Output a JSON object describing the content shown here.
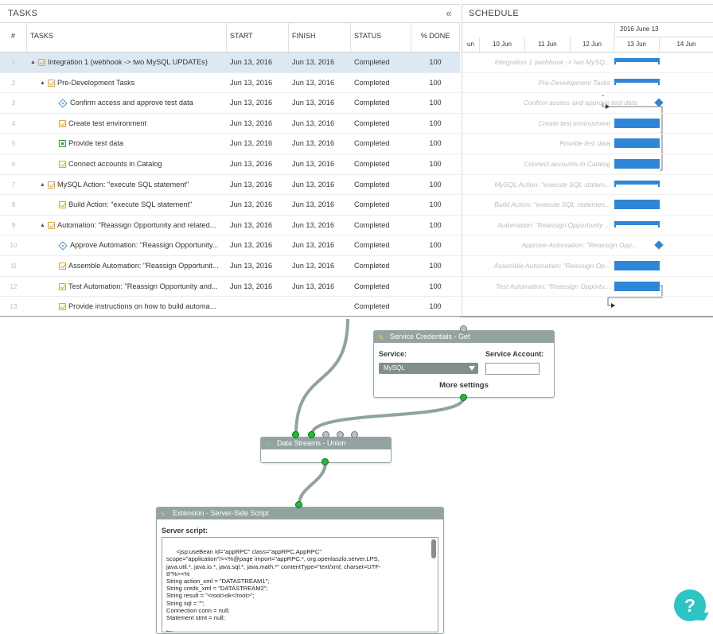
{
  "tasks_panel": {
    "title": "TASKS",
    "collapse_icon": "«",
    "columns": [
      "#",
      "TASKS",
      "START",
      "FINISH",
      "STATUS",
      "% DONE"
    ],
    "rows": [
      {
        "num": "1",
        "indent": 0,
        "expander": "▲",
        "icon": "check",
        "name": "Integration 1 (webhook -> two MySQL UPDATEs)",
        "start": "Jun 13, 2016",
        "finish": "Jun 13, 2016",
        "status": "Completed",
        "done": "100"
      },
      {
        "num": "2",
        "indent": 1,
        "expander": "▲",
        "icon": "check",
        "name": "Pre-Development Tasks",
        "start": "Jun 13, 2016",
        "finish": "Jun 13, 2016",
        "status": "Completed",
        "done": "100"
      },
      {
        "num": "3",
        "indent": 2,
        "expander": "",
        "icon": "dia",
        "name": "Confirm access and approve test data",
        "start": "Jun 13, 2016",
        "finish": "Jun 13, 2016",
        "status": "Completed",
        "done": "100"
      },
      {
        "num": "4",
        "indent": 2,
        "expander": "",
        "icon": "check",
        "name": "Create test environment",
        "start": "Jun 13, 2016",
        "finish": "Jun 13, 2016",
        "status": "Completed",
        "done": "100"
      },
      {
        "num": "5",
        "indent": 2,
        "expander": "",
        "icon": "green",
        "name": "Provide test data",
        "start": "Jun 13, 2016",
        "finish": "Jun 13, 2016",
        "status": "Completed",
        "done": "100"
      },
      {
        "num": "6",
        "indent": 2,
        "expander": "",
        "icon": "check",
        "name": "Connect accounts in Catalog",
        "start": "Jun 13, 2016",
        "finish": "Jun 13, 2016",
        "status": "Completed",
        "done": "100"
      },
      {
        "num": "7",
        "indent": 1,
        "expander": "▲",
        "icon": "check",
        "name": "MySQL Action: \"execute SQL statement\"",
        "start": "Jun 13, 2016",
        "finish": "Jun 13, 2016",
        "status": "Completed",
        "done": "100"
      },
      {
        "num": "8",
        "indent": 2,
        "expander": "",
        "icon": "check",
        "name": "Build Action: \"execute SQL statement\"",
        "start": "Jun 13, 2016",
        "finish": "Jun 13, 2016",
        "status": "Completed",
        "done": "100"
      },
      {
        "num": "9",
        "indent": 1,
        "expander": "▲",
        "icon": "check",
        "name": "Automation: \"Reassign Opportunity and related...",
        "start": "Jun 13, 2016",
        "finish": "Jun 13, 2016",
        "status": "Completed",
        "done": "100"
      },
      {
        "num": "10",
        "indent": 2,
        "expander": "",
        "icon": "dia",
        "name": "Approve Automation: \"Reassign Opportunity...",
        "start": "Jun 13, 2016",
        "finish": "Jun 13, 2016",
        "status": "Completed",
        "done": "100"
      },
      {
        "num": "11",
        "indent": 2,
        "expander": "",
        "icon": "check",
        "name": "Assemble Automation: \"Reassign Opportunit...",
        "start": "Jun 13, 2016",
        "finish": "Jun 13, 2016",
        "status": "Completed",
        "done": "100"
      },
      {
        "num": "12",
        "indent": 2,
        "expander": "",
        "icon": "check",
        "name": "Test Automation: \"Reassign Opportunity and...",
        "start": "Jun 13, 2016",
        "finish": "Jun 13, 2016",
        "status": "Completed",
        "done": "100"
      },
      {
        "num": "13",
        "indent": 2,
        "expander": "",
        "icon": "check",
        "name": "Provide instructions on how to build automa...",
        "start": "",
        "finish": "",
        "status": "Completed",
        "done": "100"
      }
    ]
  },
  "schedule_panel": {
    "title": "SCHEDULE",
    "date_header": "2016 June 13",
    "days": [
      "un",
      "10 Jun",
      "11 Jun",
      "12 Jun",
      "13 Jun",
      "14 Jun"
    ],
    "rows": [
      {
        "label": "Integration 1 (webhook -> two MySQ...",
        "kind": "summary"
      },
      {
        "label": "Pre-Development Tasks",
        "kind": "summary"
      },
      {
        "label": "Confirm access and approve test data",
        "kind": "milestone"
      },
      {
        "label": "Create test environment",
        "kind": "task"
      },
      {
        "label": "Provide test data",
        "kind": "task"
      },
      {
        "label": "Connect accounts in Catalog",
        "kind": "task"
      },
      {
        "label": "MySQL Action: \"execute SQL statem...",
        "kind": "summary"
      },
      {
        "label": "Build Action: \"execute SQL statemen...",
        "kind": "task"
      },
      {
        "label": "Automation: \"Reassign Opportunity ...",
        "kind": "summary"
      },
      {
        "label": "Approve Automation: \"Reassign Opp...",
        "kind": "milestone"
      },
      {
        "label": "Assemble Automation: \"Reassign Op...",
        "kind": "task"
      },
      {
        "label": "Test Automation: \"Reassign Opportu...",
        "kind": "task"
      },
      {
        "label": "",
        "kind": "none"
      }
    ]
  },
  "service_node": {
    "title": "Service Credentials - Get",
    "service_label": "Service:",
    "account_label": "Service Account:",
    "service_value": "MySQL",
    "account_value": "",
    "more_settings": "More settings"
  },
  "union_node": {
    "title": "Data Streams - Union"
  },
  "script_node": {
    "title": "Extension - Server-Side Script",
    "script_label": "Server script:",
    "code": "<jsp:useBean id=\"appRPC\" class=\"appRPC.AppRPC\"\nscope=\"application\"/><%@page import=\"appRPC.*, org.openlaszlo.server.LPS,\njava.util.*, java.io.*, java.sql.*, java.math.*\" contentType=\"text/xml; charset=UTF-\n8\"%><%\nString action_xml = \"DATASTREAM1\";\nString creds_xml = \"DATASTREAM2\";\nString result = \"<root>ok</root>\";\nString sql = \"\";\nConnection conn = null;\nStatement stmt = null;\n\ntry"
  },
  "help_button": {
    "label": "?"
  },
  "colors": {
    "bar": "#2e86d6",
    "node_title": "#93a3a2",
    "port_green": "#1fbb3a",
    "help": "#2dc4c4",
    "selected_row": "#dde8f5"
  }
}
